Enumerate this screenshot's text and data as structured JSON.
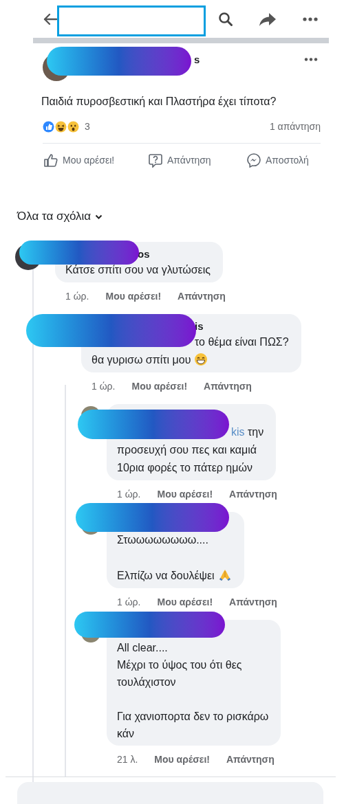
{
  "post": {
    "author_fragment": "s",
    "text": "Παιδιά πυροσβεστική και Πλαστήρα έχει τίποτα?",
    "reaction_count": "3",
    "reply_count": "1 απάντηση",
    "actions": [
      {
        "kind": "like",
        "label": "Μου αρέσει!"
      },
      {
        "kind": "reply",
        "label": "Απάντηση"
      },
      {
        "kind": "send",
        "label": "Αποστολή"
      }
    ]
  },
  "comment_filter": {
    "label": "Όλα τα σχόλια"
  },
  "comments": [
    {
      "author_fragment": "os",
      "paragraphs": [
        [
          "Κάτσε σπίτι σου να γλυτώσεις"
        ]
      ],
      "time": "1 ώρ.",
      "like": "Μου αρέσει!",
      "reply": "Απάντηση",
      "children": [
        {
          "author_fragment": "is",
          "lead_line": {
            "text": "το θέμα είναι ΠΩΣ?"
          },
          "paragraphs": [
            [
              "θα γυρισω σπίτι μου"
            ]
          ],
          "trailing_icon": {
            "kind": "grin"
          },
          "time": "1 ώρ.",
          "like": "Μου αρέσει!",
          "reply": "Απάντηση",
          "children": [
            {
              "lead_line": {
                "mention": "kis",
                "text": "την"
              },
              "paragraphs": [
                [
                  "προσευχή σου πες και καμιά",
                  "10ρια φορές το πάτερ ημών"
                ]
              ],
              "time": "1 ώρ.",
              "like": "Μου αρέσει!",
              "reply": "Απάντηση"
            },
            {
              "paragraphs": [
                [
                  "Στωωωωωωωω...."
                ],
                [
                  "Ελπίζω να δουλέψει"
                ]
              ],
              "trailing_icon": {
                "kind": "pray"
              },
              "time": "1 ώρ.",
              "like": "Μου αρέσει!",
              "reply": "Απάντηση"
            },
            {
              "paragraphs": [
                [
                  "All clear....",
                  "Μέχρι το ύψος του ότι θες",
                  "τουλάχιστον"
                ],
                [
                  "Για χανιοπορτα δεν το ρισκάρω",
                  "κάν"
                ]
              ],
              "time": "21 λ.",
              "like": "Μου αρέσει!",
              "reply": "Απάντηση"
            }
          ]
        }
      ]
    }
  ]
}
